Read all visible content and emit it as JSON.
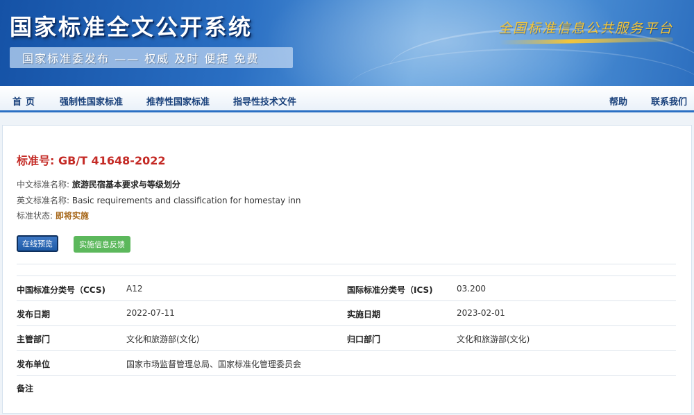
{
  "header": {
    "site_title": "国家标准全文公开系统",
    "subtitle": "国家标准委发布 —— 权威 及时 便捷 免费",
    "platform_name": "全国标准信息公共服务平台"
  },
  "nav": {
    "left": [
      "首页",
      "强制性国家标准",
      "推荐性国家标准",
      "指导性技术文件"
    ],
    "right": [
      "帮助",
      "联系我们"
    ]
  },
  "standard": {
    "number_label": "标准号:",
    "number": "GB/T 41648-2022",
    "cn_name_label": "中文标准名称:",
    "cn_name": "旅游民宿基本要求与等级划分",
    "en_name_label": "英文标准名称:",
    "en_name": "Basic requirements and classification for homestay inn",
    "status_label": "标准状态:",
    "status": "即将实施",
    "status_color": "#a8691c"
  },
  "buttons": {
    "preview": "在线预览",
    "feedback": "实施信息反馈"
  },
  "details": {
    "ccs_label": "中国标准分类号（CCS)",
    "ccs": "A12",
    "ics_label": "国际标准分类号（ICS)",
    "ics": "03.200",
    "publish_date_label": "发布日期",
    "publish_date": "2022-07-11",
    "implement_date_label": "实施日期",
    "implement_date": "2023-02-01",
    "authority_label": "主管部门",
    "authority": "文化和旅游部(文化)",
    "centralized_label": "归口部门",
    "centralized": "文化和旅游部(文化)",
    "publisher_label": "发布单位",
    "publisher": "国家市场监督管理总局、国家标准化管理委员会",
    "remarks_label": "备注",
    "remarks": ""
  },
  "colors": {
    "brand_blue": "#2a6fc3",
    "standard_number_red": "#c42a25",
    "feedback_green": "#5cb85c"
  }
}
